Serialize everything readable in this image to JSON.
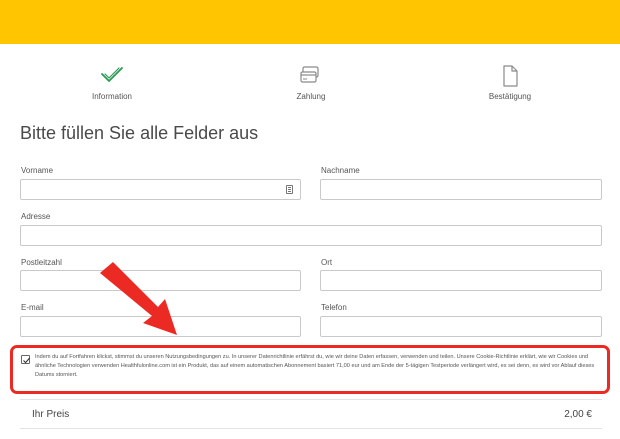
{
  "steps": [
    {
      "label": "Information",
      "icon": "checkmark-icon",
      "state": "complete",
      "color": "#2a9a52"
    },
    {
      "label": "Zahlung",
      "icon": "credit-card-icon",
      "state": "pending"
    },
    {
      "label": "Bestätigung",
      "icon": "document-icon",
      "state": "pending"
    }
  ],
  "form": {
    "title": "Bitte füllen Sie alle Felder aus",
    "fields": {
      "vorname": {
        "label": "Vorname",
        "value": "",
        "placeholder": ""
      },
      "nachname": {
        "label": "Nachname",
        "value": "",
        "placeholder": ""
      },
      "adresse": {
        "label": "Adresse",
        "value": "",
        "placeholder": ""
      },
      "postleitzahl": {
        "label": "Postleitzahl",
        "value": "",
        "placeholder": ""
      },
      "ort": {
        "label": "Ort",
        "value": "",
        "placeholder": ""
      },
      "email": {
        "label": "E-mail",
        "value": "",
        "placeholder": ""
      },
      "telefon": {
        "label": "Telefon",
        "value": "",
        "placeholder": ""
      }
    }
  },
  "consent": {
    "checked": true,
    "text": "Indem du auf Fortfahren klickst, stimmst du unseren Nutzungsbedingungen zu. In unserer Datenrichtlinie erfährst du, wie wir deine Daten erfassen, verwenden und teilen. Unsere Cookie-Richtlinie erklärt, wie wir Cookies und ähnliche Technologien verwenden Healthfulonline.com ist ein Produkt, das auf einem automatischen Abonnement basiert 71,00 eur und am Ende der 5-tägigen Testperiode verlängert wird, es sei denn, es wird vor Ablauf dieses Datums storniert."
  },
  "price": {
    "label": "Ihr Preis",
    "value": "2,00 €"
  },
  "colors": {
    "brand_yellow": "#ffc600",
    "highlight_red": "#ec2a24",
    "success_green": "#2a9a52"
  }
}
